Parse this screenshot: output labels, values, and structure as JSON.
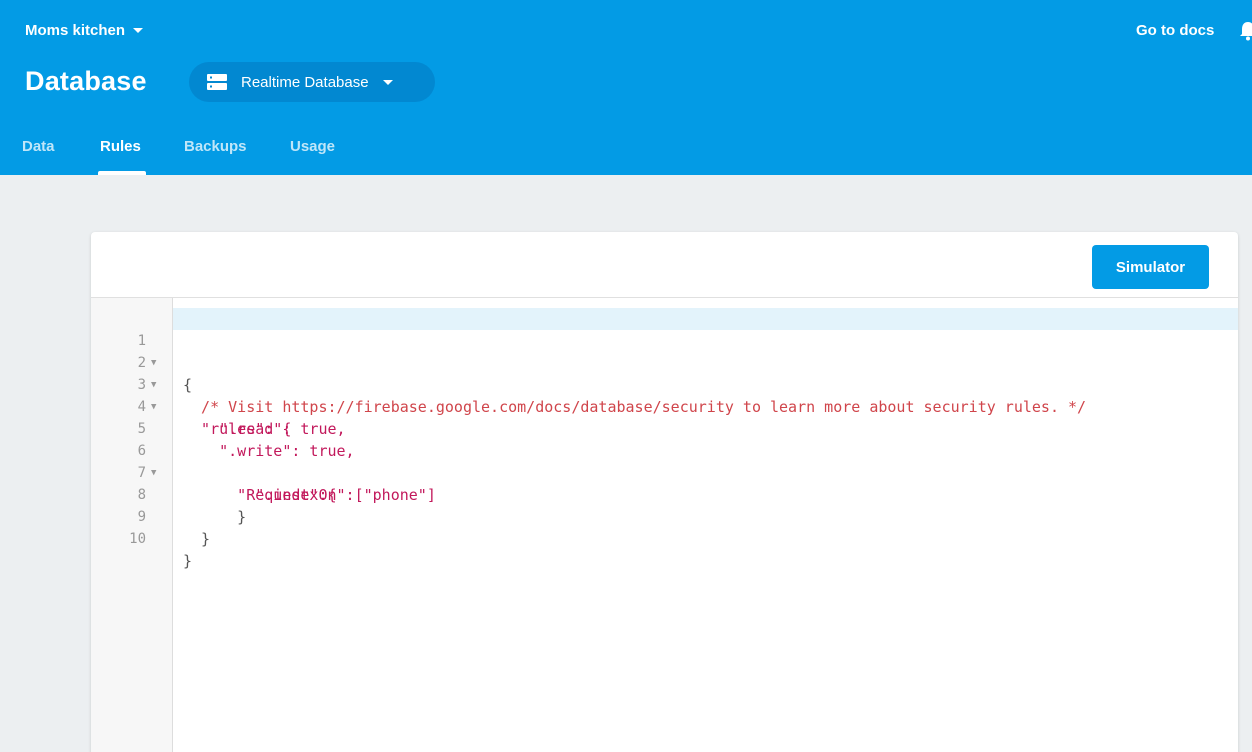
{
  "header": {
    "project_name": "Moms kitchen",
    "go_to_docs": "Go to docs",
    "page_title": "Database",
    "db_selector": "Realtime Database",
    "brand_color": "#039be5"
  },
  "tabs": [
    {
      "label": "Data",
      "active": false
    },
    {
      "label": "Rules",
      "active": true
    },
    {
      "label": "Backups",
      "active": false
    },
    {
      "label": "Usage",
      "active": false
    }
  ],
  "toolbar": {
    "simulator_label": "Simulator"
  },
  "editor": {
    "line_numbers": [
      "1",
      "2",
      "3",
      "4",
      "5",
      "6",
      "7",
      "8",
      "9",
      "10"
    ],
    "lines": [
      "{",
      "  /* Visit https://firebase.google.com/docs/database/security to learn more about security rules. */",
      "  \"rules\": {",
      "    \".read\": true,",
      "    \".write\": true,",
      "      \"Request\":{",
      "        \".indexOn\":[\"phone\"]",
      "      }",
      "  }",
      "}"
    ],
    "foldable_lines": [
      1,
      2,
      3,
      6
    ]
  }
}
